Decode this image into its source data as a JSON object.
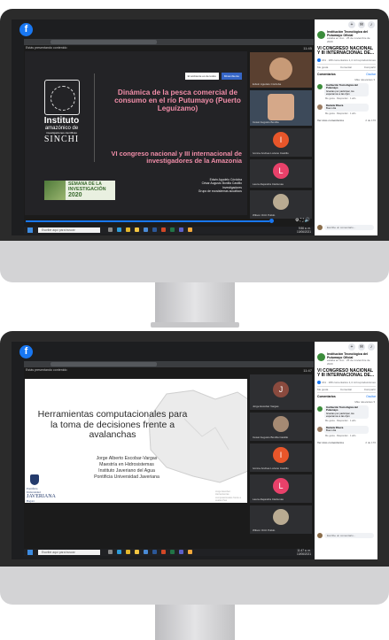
{
  "monitor1": {
    "presenting_text": "Estás presentando contenido",
    "meet_top": "11:45",
    "slide": {
      "logo_institute": "Instituto",
      "logo_sub1": "amazónico de",
      "logo_sub2": "investigaciones científicas",
      "logo_brand": "SINCHI",
      "gov_badge_1": "El ambiente es de todos",
      "gov_badge_2": "Minambiente",
      "title": "Dinámica de la pesca comercial de consumo en el río Putumayo (Puerto Leguízamo)",
      "congress": "VI congreso nacional y III internacional de investigadores de la Amazonia",
      "authors": [
        "Edwin Agudelo Córdoba",
        "César Augusto Bonilla Castillo",
        "Investigadores",
        "Grupo de ecosistemas acuáticos"
      ],
      "semana_line1": "SEMANA DE LA",
      "semana_line2": "INVESTIGACIÓN",
      "semana_line3": "2020"
    },
    "tiles": [
      {
        "name": "Edwin Agudelo Córdoba",
        "kind": "photo"
      },
      {
        "name": "César Augusto Bonilla",
        "kind": "video"
      },
      {
        "name": "Ivonne Andrea Lozano Castillo",
        "kind": "letter",
        "letter": "I",
        "color": "#e8562a"
      },
      {
        "name": "Laura Alejandra Cárdenas",
        "kind": "letter",
        "letter": "L",
        "color": "#e8416a"
      },
      {
        "name": "Wilson Ortiz Pulido",
        "kind": "photo"
      }
    ],
    "taskbar": {
      "search": "Escribe aquí para buscar",
      "time": "9:56 a. m.",
      "date": "10/06/2021"
    },
    "fb": {
      "page_name": "Institución Tecnológica del Putumayo Oficial",
      "page_sub": "estaba en vivo · 25 de noviembre de 2020",
      "post_title": "VI CONGRESO NACIONAL Y III INTERNACIONAL DE...",
      "reactions": "161 · 180 comentarios 1,4 mil reproducciones",
      "like": "Me gusta",
      "comment": "Comentar",
      "share": "Compartir",
      "comments_label": "Comentarios",
      "hide": "Ocultar",
      "relevant": "Más relevantes ▾",
      "c1_author": "Institución Tecnológica del Putumayo",
      "c1_text": "Gracias por participar, los esperamos a las 2pm",
      "c1_meta": "Me gusta · Responder · 1 año",
      "c2_author": "Daniela Rivera",
      "c2_text": "Buen día",
      "c2_meta": "Me gusta · Responder · 1 año",
      "more": "Ver más comentarios",
      "more_count": "2 de 176",
      "write": "Escribe un comentario..."
    }
  },
  "monitor2": {
    "presenting_text": "Estás presentando contenido",
    "meet_top": "11:47",
    "slide": {
      "title": "Herramientas computacionales para la toma de decisiones frente a avalanchas",
      "lines": [
        "Jorge Alberto Escobar-Vargas",
        "Maestría en Hidrosistemas",
        "Instituto Javeriano del Agua",
        "Pontificia Universidad Javeriana"
      ],
      "puj_1": "Pontificia Universidad",
      "puj_2": "JAVERIANA",
      "puj_3": "Bogotá",
      "sign": "Jorge Escobar · Herramientas computacionales frente a avalanchas"
    },
    "tiles": [
      {
        "name": "Jorge Escobar Vargas",
        "kind": "letter",
        "letter": "J",
        "color": "#8a4a3e"
      },
      {
        "name": "César Augusto Bonilla Castillo",
        "kind": "photo"
      },
      {
        "name": "Ivonne Andrea Lozano Castillo",
        "kind": "letter",
        "letter": "I",
        "color": "#e8562a"
      },
      {
        "name": "Laura Alejandra Cárdenas",
        "kind": "letter",
        "letter": "L",
        "color": "#e8416a"
      },
      {
        "name": "Wilson Ortiz Pulido",
        "kind": "photo"
      }
    ],
    "taskbar": {
      "search": "Escribe aquí para buscar",
      "time": "11:47 a. m.",
      "date": "10/06/2021"
    },
    "fb": {
      "page_name": "Institución Tecnológica del Putumayo Oficial",
      "page_sub": "estaba en vivo · 25 de noviembre de 2020",
      "post_title": "VI CONGRESO NACIONAL Y III INTERNACIONAL DE...",
      "reactions": "161 · 180 comentarios 1,4 mil reproducciones",
      "like": "Me gusta",
      "comment": "Comentar",
      "share": "Compartir",
      "comments_label": "Comentarios",
      "hide": "Ocultar",
      "relevant": "Más relevantes ▾",
      "c1_author": "Institución Tecnológica del Putumayo",
      "c1_text": "Gracias por participar, los esperamos a las 2pm",
      "c1_meta": "Me gusta · Responder · 1 año",
      "c2_author": "Daniela Rivera",
      "c2_text": "Buen día",
      "c2_meta": "Me gusta · Responder · 1 año",
      "more": "Ver más comentarios",
      "more_count": "2 de 176",
      "write": "Escribe un comentario..."
    }
  }
}
